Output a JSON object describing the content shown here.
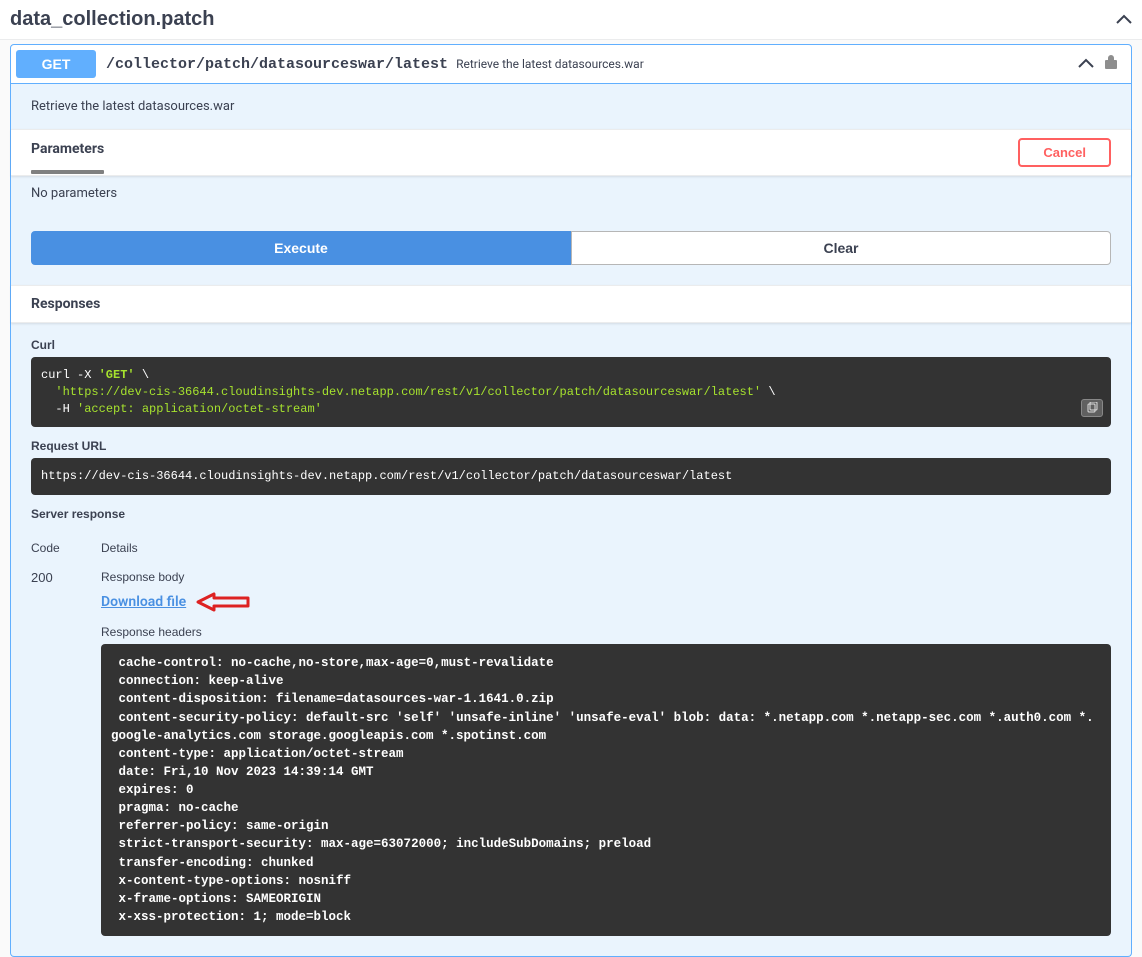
{
  "section": {
    "title": "data_collection.patch"
  },
  "operation": {
    "method": "GET",
    "path": "/collector/patch/datasourceswar/latest",
    "summary": "Retrieve the latest datasources.war",
    "description": "Retrieve the latest datasources.war"
  },
  "parameters": {
    "title": "Parameters",
    "cancel_label": "Cancel",
    "empty_text": "No parameters"
  },
  "buttons": {
    "execute": "Execute",
    "clear": "Clear"
  },
  "responses": {
    "title": "Responses",
    "curl_label": "Curl",
    "curl_prefix": "curl -X ",
    "curl_method": "'GET'",
    "curl_url": "'https://dev-cis-36644.cloudinsights-dev.netapp.com/rest/v1/collector/patch/datasourceswar/latest'",
    "curl_h": "-H ",
    "curl_header_val": "'accept: application/octet-stream'",
    "request_url_label": "Request URL",
    "request_url": "https://dev-cis-36644.cloudinsights-dev.netapp.com/rest/v1/collector/patch/datasourceswar/latest",
    "server_response_label": "Server response",
    "code_header": "Code",
    "details_header": "Details",
    "status_code": "200",
    "response_body_label": "Response body",
    "download_label": "Download file",
    "response_headers_label": "Response headers",
    "response_headers": " cache-control: no-cache,no-store,max-age=0,must-revalidate \n connection: keep-alive \n content-disposition: filename=datasources-war-1.1641.0.zip \n content-security-policy: default-src 'self' 'unsafe-inline' 'unsafe-eval' blob: data: *.netapp.com *.netapp-sec.com *.auth0.com *.google-analytics.com storage.googleapis.com *.spotinst.com \n content-type: application/octet-stream \n date: Fri,10 Nov 2023 14:39:14 GMT \n expires: 0 \n pragma: no-cache \n referrer-policy: same-origin \n strict-transport-security: max-age=63072000; includeSubDomains; preload \n transfer-encoding: chunked \n x-content-type-options: nosniff \n x-frame-options: SAMEORIGIN \n x-xss-protection: 1; mode=block "
  }
}
